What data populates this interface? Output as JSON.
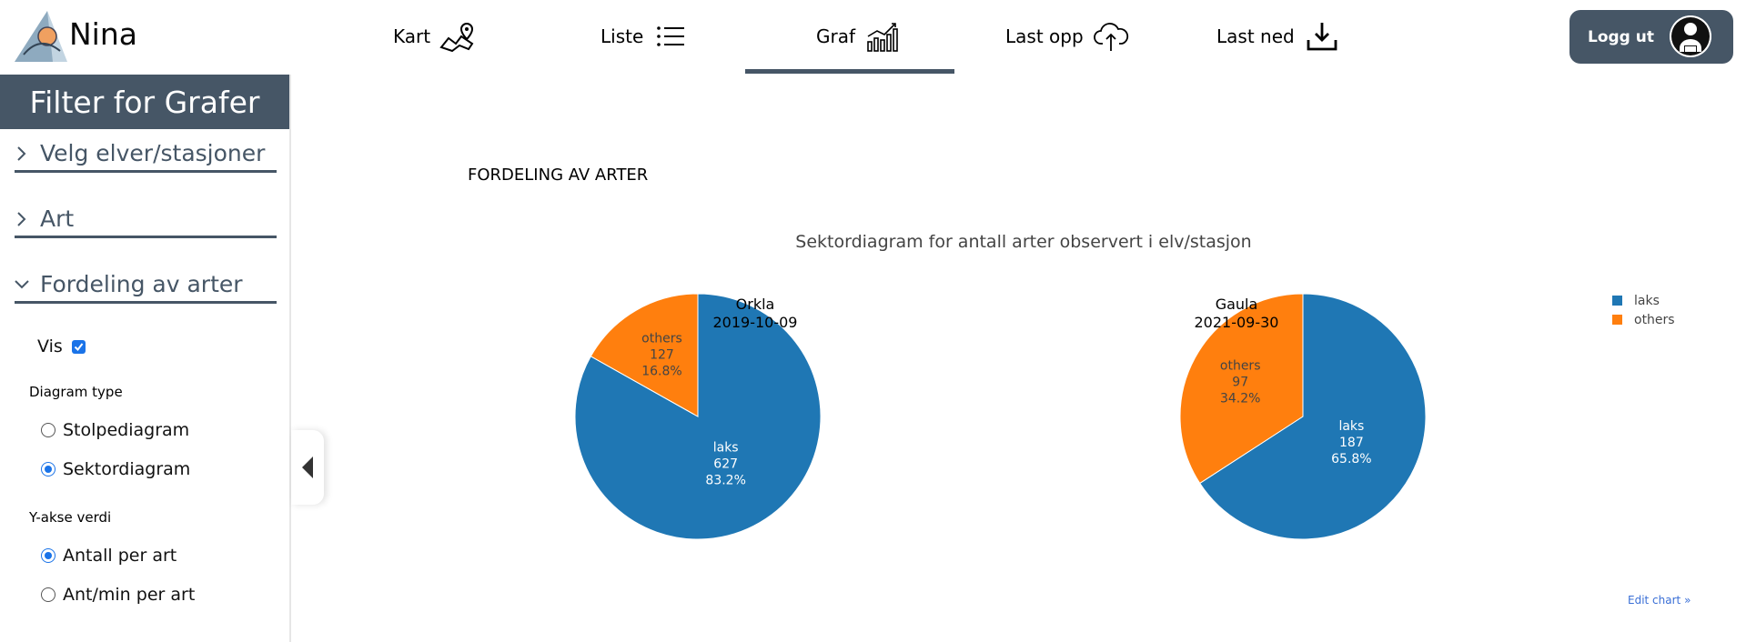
{
  "app": {
    "brand": "Nina"
  },
  "nav": {
    "items": [
      {
        "label": "Kart",
        "icon": "map-pin-icon"
      },
      {
        "label": "Liste",
        "icon": "list-icon"
      },
      {
        "label": "Graf",
        "icon": "bar-chart-icon",
        "active": true
      },
      {
        "label": "Last opp",
        "icon": "cloud-upload-icon"
      },
      {
        "label": "Last ned",
        "icon": "download-icon"
      }
    ],
    "logout_label": "Logg ut"
  },
  "sidebar": {
    "title": "Filter for Grafer",
    "sections": [
      {
        "label": "Velg elver/stasjoner",
        "expanded": false
      },
      {
        "label": "Art",
        "expanded": false
      },
      {
        "label": "Fordeling av arter",
        "expanded": true
      }
    ],
    "vis_label": "Vis",
    "vis_checked": true,
    "diagram_type_label": "Diagram type",
    "diagram_types": [
      {
        "label": "Stolpediagram",
        "selected": false
      },
      {
        "label": "Sektordiagram",
        "selected": true
      }
    ],
    "yaxis_label": "Y-akse verdi",
    "yaxis_options": [
      {
        "label": "Antall per art",
        "selected": true
      },
      {
        "label": "Ant/min per art",
        "selected": false
      }
    ]
  },
  "main": {
    "section_title": "FORDELING AV ARTER",
    "edit_chart": "Edit chart »"
  },
  "colors": {
    "accent": "#465666",
    "laks": "#1f77b4",
    "others": "#ff7f0e",
    "link": "#3a6fd6"
  },
  "chart_data": {
    "type": "pie",
    "title": "Sektordiagram for antall arter observert i elv/stasjon",
    "legend": {
      "placement": "top-right",
      "entries": [
        "laks",
        "others"
      ]
    },
    "pies": [
      {
        "title_lines": [
          "Orkla",
          "2019-10-09"
        ],
        "slices": [
          {
            "label": "laks",
            "value": 627,
            "percent": "83.2%"
          },
          {
            "label": "others",
            "value": 127,
            "percent": "16.8%"
          }
        ]
      },
      {
        "title_lines": [
          "Gaula",
          "2021-09-30"
        ],
        "slices": [
          {
            "label": "laks",
            "value": 187,
            "percent": "65.8%"
          },
          {
            "label": "others",
            "value": 97,
            "percent": "34.2%"
          }
        ]
      }
    ]
  }
}
